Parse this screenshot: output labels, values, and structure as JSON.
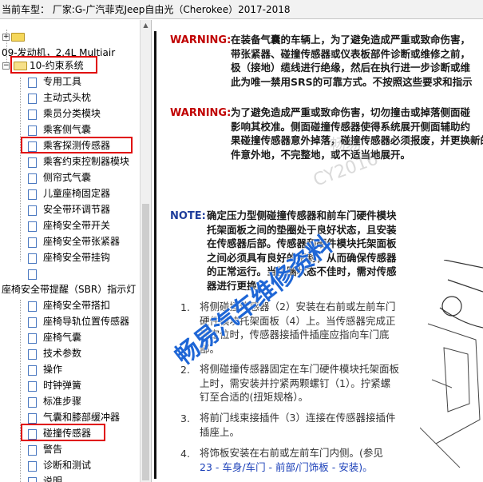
{
  "window": {
    "title": "当前车型：  厂家:G-广汽菲克Jeep自由光（Cherokee）2017-2018"
  },
  "tree": {
    "items": [
      {
        "label": ""
      },
      {
        "label": "09-发动机，2.4L Multiair"
      },
      {
        "label": "10-约束系统"
      },
      {
        "label": "专用工具"
      },
      {
        "label": "主动式头枕"
      },
      {
        "label": "乘员分类模块"
      },
      {
        "label": "乘客侧气囊"
      },
      {
        "label": "乘客探测传感器"
      },
      {
        "label": "乘客约束控制器模块"
      },
      {
        "label": "侧帘式气囊"
      },
      {
        "label": "儿童座椅固定器"
      },
      {
        "label": "安全带环调节器"
      },
      {
        "label": "座椅安全带开关"
      },
      {
        "label": "座椅安全带张紧器"
      },
      {
        "label": "座椅安全带挂钩"
      },
      {
        "label": ""
      },
      {
        "label": "座椅安全带提醒（SBR）指示灯"
      },
      {
        "label": "座椅安全带搭扣"
      },
      {
        "label": "座椅导轨位置传感器"
      },
      {
        "label": "座椅气囊"
      },
      {
        "label": "技术参数"
      },
      {
        "label": "操作"
      },
      {
        "label": "时钟弹簧"
      },
      {
        "label": "标准步骤"
      },
      {
        "label": "气囊和膝部缓冲器"
      },
      {
        "label": "碰撞传感器"
      },
      {
        "label": "警告"
      },
      {
        "label": "诊断和测试"
      },
      {
        "label": "说明"
      }
    ]
  },
  "document": {
    "warning1_label": "WARNING:",
    "warning1_lines": [
      "在装备气囊的车辆上，为了避免造成严重或致命伤害，",
      "带张紧器、碰撞传感器或仪表板部件诊断或维修之前，",
      "极（接地）缆线进行绝缘，然后在执行进一步诊断或维",
      "此为唯一禁用SRS的可靠方式。不按照这些要求和指示"
    ],
    "warning2_label": "WARNING:",
    "warning2_lines": [
      "为了避免造成严重或致命伤害，切勿撞击或掉落侧面碰",
      "影响其校准。侧面碰撞传感器使得系统展开侧面辅助约",
      "果碰撞传感器意外掉落，碰撞传感器必须报废，并更换新的",
      "件意外地，不完整地，或不适当地展开。"
    ],
    "note_label": "NOTE:",
    "note_lines": [
      "确定压力型侧碰撞传感器和前车门硬件模块",
      "托架面板之间的垫圈处于良好状态，且安装",
      "在传感器后部。传感器和硬件模块托架面板",
      "之间必须具有良好的密封，从而确保传感器",
      "的正常运行。当垫圈状态不佳时，需对传感",
      "器进行更换。"
    ],
    "steps": [
      {
        "num": "1.",
        "lines": [
          "将侧碰撞传感器（2）安装在右前或左前车门",
          "硬件模块托架面板（4）上。当传感器完成正",
          "确定位时，传感器接插件插座应指向车门底",
          "部。"
        ]
      },
      {
        "num": "2.",
        "lines": [
          "将侧碰撞传感器固定在车门硬件模块托架面板",
          "上时，需安装并拧紧两颗螺钉（1）。拧紧螺",
          "钉至合适的(扭矩规格）。"
        ]
      },
      {
        "num": "3.",
        "lines": [
          "将前门线束接插件（3）连接在传感器接插件",
          "插座上。"
        ]
      },
      {
        "num": "4.",
        "lines": [
          "将饰板安装在右前或左前车门内侧。(参见",
          "23 - 车身/车门 - 前部/门饰板 - 安装)。"
        ]
      }
    ],
    "watermark_small1": "畅易",
    "watermark_small2": "CY2016",
    "watermark_big": "畅易汽车维修资料"
  },
  "colors": {
    "warning": "#c00000",
    "note": "#1e3d9b",
    "highlight": "#e00000",
    "watermark": "#1e66d6"
  }
}
